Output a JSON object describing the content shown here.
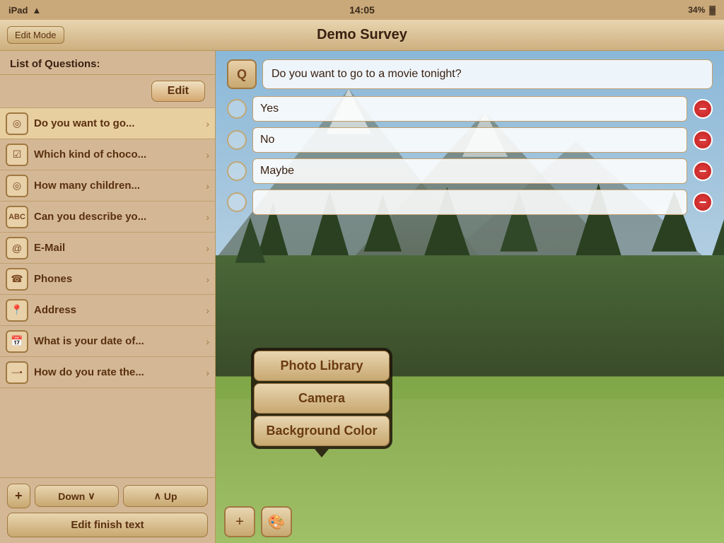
{
  "statusBar": {
    "carrier": "iPad",
    "wifi": "wifi",
    "time": "14:05",
    "battery": "34%"
  },
  "titleBar": {
    "title": "Demo Survey",
    "editModeLabel": "Edit Mode"
  },
  "sidebar": {
    "header": "List of Questions:",
    "editButton": "Edit",
    "questions": [
      {
        "id": 1,
        "icon": "◎",
        "label": "Do you want to go...",
        "active": true
      },
      {
        "id": 2,
        "icon": "☑",
        "label": "Which kind of choco..."
      },
      {
        "id": 3,
        "icon": "◎",
        "label": "How many children..."
      },
      {
        "id": 4,
        "icon": "ABC",
        "label": "Can you describe yo..."
      },
      {
        "id": 5,
        "icon": "@",
        "label": "E-Mail"
      },
      {
        "id": 6,
        "icon": "☎",
        "label": "Phones"
      },
      {
        "id": 7,
        "icon": "📍",
        "label": "Address"
      },
      {
        "id": 8,
        "icon": "📅",
        "label": "What is your date of..."
      },
      {
        "id": 9,
        "icon": "—•",
        "label": "How do you rate the..."
      }
    ],
    "toolbar": {
      "addLabel": "+",
      "downLabel": "Down",
      "downIcon": "∨",
      "upIcon": "∧",
      "upLabel": "Up",
      "editFinishLabel": "Edit finish text"
    }
  },
  "editor": {
    "questionBadge": "Q",
    "questionText": "Do you want to go to a movie tonight?",
    "answers": [
      {
        "id": 1,
        "text": "Yes"
      },
      {
        "id": 2,
        "text": "No"
      },
      {
        "id": 3,
        "text": "Maybe"
      },
      {
        "id": 4,
        "text": ""
      }
    ]
  },
  "popup": {
    "items": [
      {
        "id": 1,
        "label": "Photo Library"
      },
      {
        "id": 2,
        "label": "Camera"
      },
      {
        "id": 3,
        "label": "Background Color"
      }
    ]
  },
  "contentToolbar": {
    "addLabel": "+",
    "paletteLabel": "🎨"
  }
}
